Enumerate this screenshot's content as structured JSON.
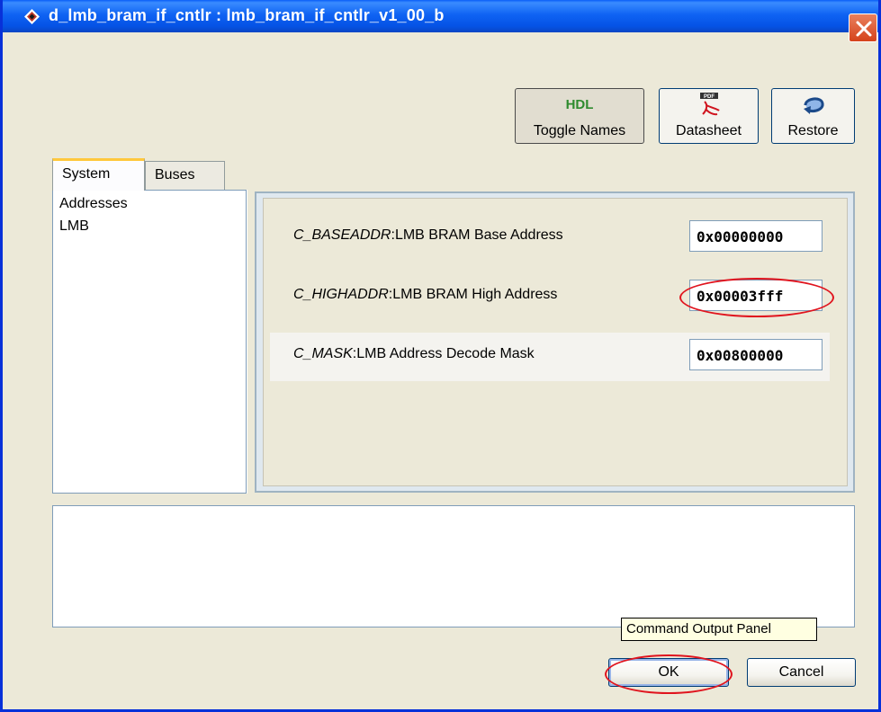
{
  "window": {
    "title": "d_lmb_bram_if_cntlr : lmb_bram_if_cntlr_v1_00_b"
  },
  "toolbar": {
    "toggle_names": {
      "icon_text": "HDL",
      "label": "Toggle Names"
    },
    "datasheet": {
      "icon_text": "PDF",
      "label": "Datasheet"
    },
    "restore": {
      "label": "Restore"
    }
  },
  "tabs": [
    {
      "label": "System",
      "active": true
    },
    {
      "label": "Buses",
      "active": false
    }
  ],
  "sidebar": {
    "items": [
      {
        "label": "Addresses"
      },
      {
        "label": "LMB"
      }
    ]
  },
  "params": [
    {
      "name": "C_BASEADDR",
      "desc": "LMB BRAM Base Address",
      "value": "0x00000000"
    },
    {
      "name": "C_HIGHADDR",
      "desc": "LMB BRAM High Address",
      "value": "0x00003fff"
    },
    {
      "name": "C_MASK",
      "desc": "LMB Address Decode Mask",
      "value": "0x00800000"
    }
  ],
  "command_output": {
    "tooltip": "Command Output Panel"
  },
  "buttons": {
    "ok": "OK",
    "cancel": "Cancel"
  },
  "colors": {
    "titlebar": "#0553e6",
    "window_bg": "#ece9d8",
    "highlight_annotation": "#e0141e",
    "tab_active_accent": "#ffc83c"
  }
}
